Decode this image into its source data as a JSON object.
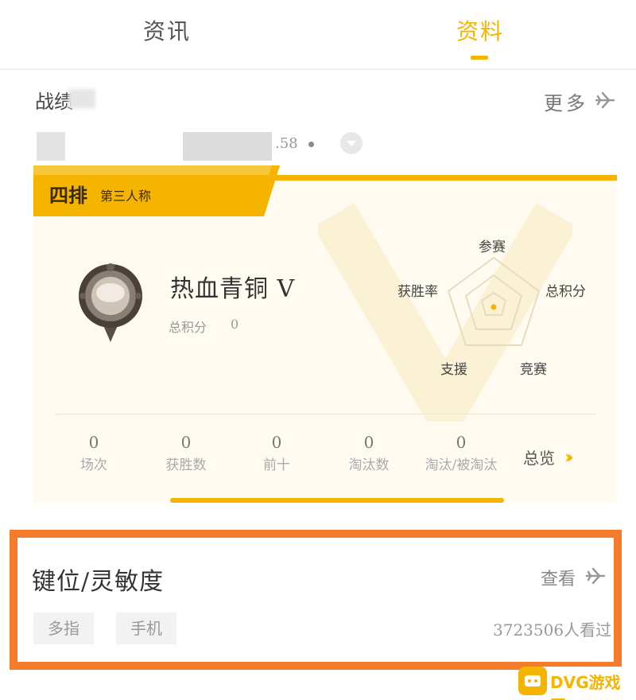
{
  "tabs": [
    {
      "label": "资讯",
      "active": false
    },
    {
      "label": "资料",
      "active": true
    }
  ],
  "record": {
    "title": "战绩",
    "more_label": "更多",
    "id_suffix": ".58"
  },
  "card": {
    "mode": "四排",
    "perspective": "第三人称",
    "rank_name": "热血青铜 V",
    "score_label": "总积分",
    "score_value": "0",
    "radar_labels": [
      "参赛",
      "总积分",
      "竞赛",
      "支援",
      "获胜率"
    ],
    "stats": [
      {
        "value": "0",
        "label": "场次"
      },
      {
        "value": "0",
        "label": "获胜数"
      },
      {
        "value": "0",
        "label": "前十"
      },
      {
        "value": "0",
        "label": "淘汰数"
      },
      {
        "value": "0",
        "label": "淘汰/被淘汰"
      }
    ],
    "overview_label": "总览"
  },
  "keybind": {
    "title": "键位/灵敏度",
    "view_label": "查看",
    "tags": [
      "多指",
      "手机"
    ],
    "views": "3723506人看过"
  },
  "watermark": {
    "text": "DVG游戏网"
  },
  "colors": {
    "accent": "#f4b400",
    "highlight": "#f47a2c"
  }
}
